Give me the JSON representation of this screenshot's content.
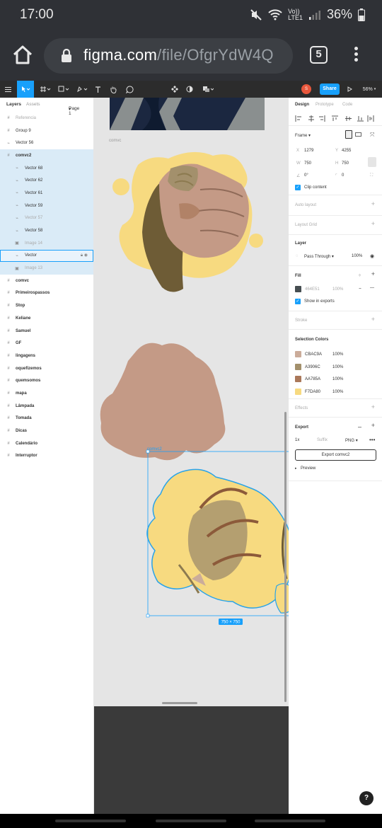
{
  "status_bar": {
    "time": "17:00",
    "network_top": "Vo))",
    "network_bottom": "LTE1",
    "battery": "36%"
  },
  "browser": {
    "url_host": "figma.com",
    "url_path": "/file/OfgrYdW4Q",
    "tab_count": "5"
  },
  "toolbar": {
    "share_label": "Share",
    "zoom": "56%",
    "avatar_initial": "S"
  },
  "layers_panel": {
    "tab_layers": "Layers",
    "tab_assets": "Assets",
    "page": "Page 1",
    "items": [
      {
        "label": "Referencia",
        "icon": "frame-icon"
      },
      {
        "label": "Group 9",
        "icon": "frame-icon"
      },
      {
        "label": "Vector 56",
        "icon": "vector-icon"
      },
      {
        "label": "comvc2",
        "icon": "frame-icon"
      },
      {
        "label": "Vector 68",
        "icon": "vector-icon"
      },
      {
        "label": "Vector 62",
        "icon": "vector-icon"
      },
      {
        "label": "Vector 61",
        "icon": "vector-icon"
      },
      {
        "label": "Vector 59",
        "icon": "vector-icon"
      },
      {
        "label": "Vector 57",
        "icon": "vector-icon"
      },
      {
        "label": "Vector 58",
        "icon": "vector-icon"
      },
      {
        "label": "Image 14",
        "icon": "image-icon"
      },
      {
        "label": "Vector",
        "icon": "vector-icon"
      },
      {
        "label": "Image 13",
        "icon": "image-icon"
      },
      {
        "label": "comvc",
        "icon": "frame-icon"
      },
      {
        "label": "Primeirospassos",
        "icon": "frame-icon"
      },
      {
        "label": "Stop",
        "icon": "frame-icon"
      },
      {
        "label": "Keliane",
        "icon": "frame-icon"
      },
      {
        "label": "Samuel",
        "icon": "frame-icon"
      },
      {
        "label": "GF",
        "icon": "frame-icon"
      },
      {
        "label": "lingagens",
        "icon": "frame-icon"
      },
      {
        "label": "oquefizemos",
        "icon": "frame-icon"
      },
      {
        "label": "quemsomos",
        "icon": "frame-icon"
      },
      {
        "label": "mapa",
        "icon": "frame-icon"
      },
      {
        "label": "Lâmpada",
        "icon": "frame-icon"
      },
      {
        "label": "Tomada",
        "icon": "frame-icon"
      },
      {
        "label": "Dicas",
        "icon": "frame-icon"
      },
      {
        "label": "Calendário",
        "icon": "frame-icon"
      },
      {
        "label": "Interruptor",
        "icon": "frame-icon"
      }
    ]
  },
  "canvas": {
    "frame_label_top": "comvc",
    "frame_label_selected": "comvc2",
    "size_badge": "750 × 750"
  },
  "design_panel": {
    "tab_design": "Design",
    "tab_prototype": "Prototype",
    "tab_code": "Code",
    "frame_label": "Frame",
    "x_label": "X",
    "x_value": "1279",
    "y_label": "Y",
    "y_value": "4255",
    "w_label": "W",
    "w_value": "750",
    "h_label": "H",
    "h_value": "750",
    "rotation": "0°",
    "radius": "0",
    "clip_content": "Clip content",
    "auto_layout": "Auto layout",
    "layout_grid": "Layout Grid",
    "layer_title": "Layer",
    "blend_mode": "Pass Through",
    "layer_opacity": "100%",
    "fill_title": "Fill",
    "fill_hex": "464E51",
    "fill_opacity": "100%",
    "show_in_exports": "Show in exports",
    "stroke": "Stroke",
    "selection_colors_title": "Selection Colors",
    "selection_colors": [
      {
        "hex": "CBAC9A",
        "opacity": "100%",
        "color": "#CBAC9A"
      },
      {
        "hex": "A3906C",
        "opacity": "100%",
        "color": "#A3906C"
      },
      {
        "hex": "AA785A",
        "opacity": "100%",
        "color": "#AA785A"
      },
      {
        "hex": "F7DA80",
        "opacity": "100%",
        "color": "#F7DA80"
      }
    ],
    "effects": "Effects",
    "export_title": "Export",
    "export_scale": "1x",
    "export_suffix": "Suffix",
    "export_format": "PNG",
    "export_button": "Export comvc2",
    "preview": "Preview"
  },
  "colors": {
    "accent": "#18a0fb",
    "skin": "#C49A86",
    "yellow": "#F7DA80",
    "shadow": "#6E5C36"
  }
}
